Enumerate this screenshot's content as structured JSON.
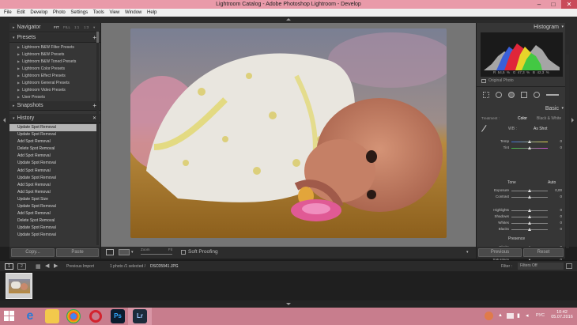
{
  "window": {
    "title": "Lightroom Catalog - Adobe Photoshop Lightroom - Develop",
    "minimize": "–",
    "maximize": "□",
    "close": "✕"
  },
  "menu": [
    "File",
    "Edit",
    "Develop",
    "Photo",
    "Settings",
    "Tools",
    "View",
    "Window",
    "Help"
  ],
  "navigator": {
    "title": "Navigator",
    "zoom_options": [
      "FIT",
      "FILL",
      "1:1",
      "1:3"
    ],
    "zoom_icon": "▾"
  },
  "presets": {
    "title": "Presets",
    "add": "+",
    "items": [
      "Lightroom B&W Filter Presets",
      "Lightroom B&W Presets",
      "Lightroom B&W Toned Presets",
      "Lightroom Color Presets",
      "Lightroom Effect Presets",
      "Lightroom General Presets",
      "Lightroom Video Presets",
      "User Presets"
    ]
  },
  "snapshots": {
    "title": "Snapshots",
    "add": "+"
  },
  "history": {
    "title": "History",
    "clear": "✕",
    "items": [
      "Update Spot Removal",
      "Update Spot Removal",
      "Add Spot Removal",
      "Delete Spot Removal",
      "Add Spot Removal",
      "Update Spot Removal",
      "Add Spot Removal",
      "Update Spot Removal",
      "Add Spot Removal",
      "Add Spot Removal",
      "Update Spot Size",
      "Update Spot Removal",
      "Add Spot Removal",
      "Delete Spot Removal",
      "Update Spot Removal",
      "Update Spot Removal"
    ]
  },
  "left_buttons": {
    "copy": "Copy...",
    "paste": "Paste"
  },
  "toolbar": {
    "zoom_label": "Zoom",
    "fit_label": "Fit",
    "soft_proofing": "Soft Proofing"
  },
  "histogram": {
    "title": "Histogram",
    "readout": {
      "r_label": "R",
      "r": "54,5",
      "g_label": "G",
      "g": "47,3",
      "b_label": "B",
      "b": "42,3",
      "unit": "%"
    },
    "original_photo": "Original Photo"
  },
  "basic": {
    "title": "Basic",
    "treatment_label": "Treatment :",
    "color": "Color",
    "bw": "Black & White",
    "wb_label": "WB :",
    "wb_value": "As Shot",
    "tone_label": "Tone",
    "auto": "Auto",
    "presence_label": "Presence",
    "sliders": [
      {
        "label": "Temp",
        "value": "0",
        "level": 0.5
      },
      {
        "label": "Tint",
        "value": "0",
        "level": 0.5
      },
      {
        "label": "Exposure",
        "value": "0,00",
        "level": 0.5
      },
      {
        "label": "Contrast",
        "value": "0",
        "level": 0.5
      },
      {
        "label": "Highlights",
        "value": "0",
        "level": 0.5
      },
      {
        "label": "Shadows",
        "value": "0",
        "level": 0.5
      },
      {
        "label": "Whites",
        "value": "0",
        "level": 0.5
      },
      {
        "label": "Blacks",
        "value": "0",
        "level": 0.5
      },
      {
        "label": "Clarity",
        "value": "0",
        "level": 0.5
      },
      {
        "label": "Vibrance",
        "value": "0",
        "level": 0.5
      },
      {
        "label": "Saturation",
        "value": "0",
        "level": 0.5
      }
    ]
  },
  "right_buttons": {
    "previous": "Previous",
    "reset": "Reset"
  },
  "filmbar": {
    "screen1": "1",
    "screen2": "2",
    "previous_import": "Previous Import",
    "photo_count": "1 photo /1 selected /",
    "filename": "DSC05941.JPG",
    "filter_label": "Filter :",
    "filter_value": "Filters Off"
  },
  "taskbar": {
    "time": "10:42",
    "date": "05.07.2016",
    "lang": "РУС",
    "ps_label": "Ps",
    "lr_label": "Lr"
  },
  "colors": {
    "titlebar": "#e99aa9",
    "taskbar": "#c87d8d",
    "panel": "#363636",
    "center": "#757575"
  }
}
